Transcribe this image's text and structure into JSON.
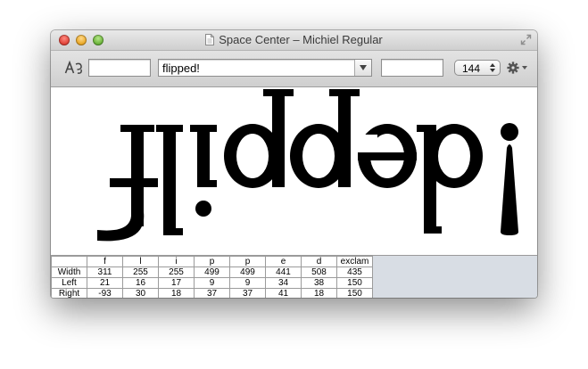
{
  "window": {
    "title": "Space Center – Michiel Regular"
  },
  "toolbar": {
    "pre_text": "",
    "text": "flipped!",
    "after_text": "",
    "point_size": "144"
  },
  "icons": {
    "glyph_toggle": "rotated-A-icon",
    "document": "document-icon",
    "fullscreen": "fullscreen-icon",
    "combo_arrow": "triangle-down-icon",
    "stepper": "up-down-arrows-icon",
    "gear": "gear-icon"
  },
  "preview": {
    "rotation": "180deg"
  },
  "metrics": {
    "row_labels": [
      "Width",
      "Left",
      "Right"
    ],
    "glyphs": [
      {
        "name": "f",
        "width": "311",
        "left": "21",
        "right": "-93"
      },
      {
        "name": "l",
        "width": "255",
        "left": "16",
        "right": "30"
      },
      {
        "name": "i",
        "width": "255",
        "left": "17",
        "right": "18"
      },
      {
        "name": "p",
        "width": "499",
        "left": "9",
        "right": "37"
      },
      {
        "name": "p",
        "width": "499",
        "left": "9",
        "right": "37"
      },
      {
        "name": "e",
        "width": "441",
        "left": "34",
        "right": "41"
      },
      {
        "name": "d",
        "width": "508",
        "left": "38",
        "right": "18"
      },
      {
        "name": "exclam",
        "width": "435",
        "left": "150",
        "right": "150"
      }
    ]
  }
}
